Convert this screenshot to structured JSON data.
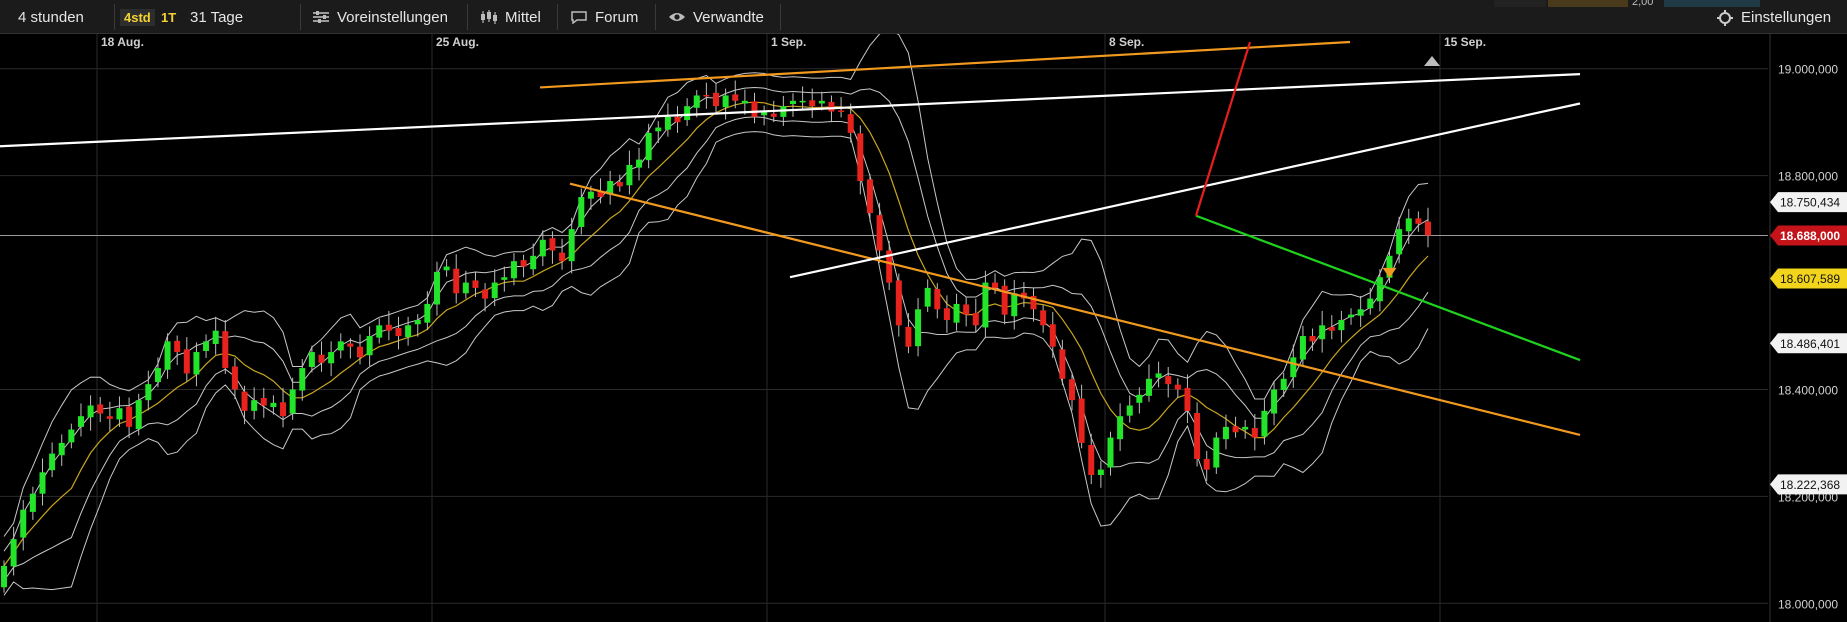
{
  "toolbar": {
    "interval": "4 stunden",
    "tf_4std": "4std",
    "tf_1t": "1T",
    "range": "31 Tage",
    "presets": "Voreinstellungen",
    "averages": "Mittel",
    "forum": "Forum",
    "related": "Verwandte",
    "settings": "Einstellungen",
    "top_value": "2,00"
  },
  "colors": {
    "bull": "#22e52a",
    "bear": "#e8221c",
    "orange": "#f19a1f",
    "white": "#ffffff",
    "green": "#1fd21f",
    "red": "#e81d1d",
    "gold": "#c8a520",
    "band": "#c8c8c8",
    "grid": "#2a2a2a"
  },
  "chart_data": {
    "type": "candlestick",
    "title": "",
    "xlabel": "",
    "ylabel": "",
    "ylim": [
      17965,
      19065
    ],
    "y_axis_side": "right",
    "grid": true,
    "y_ticks": [
      "19.000,000",
      "18.800,000",
      "18.400,000",
      "18.200,000",
      "18.000,000"
    ],
    "x_ticks": [
      "18 Aug.",
      "25 Aug.",
      "1 Sep.",
      "8 Sep.",
      "15 Sep."
    ],
    "price_labels": [
      {
        "text": "18.750,434",
        "value": 18750.434,
        "style": "white"
      },
      {
        "text": "18.688,000",
        "value": 18688.0,
        "style": "red"
      },
      {
        "text": "18.607,589",
        "value": 18607.589,
        "style": "yellow"
      },
      {
        "text": "18.486,401",
        "value": 18486.401,
        "style": "white"
      },
      {
        "text": "18.222,368",
        "value": 18222.368,
        "style": "white"
      }
    ],
    "current_price": 18688.0,
    "candle_closes": [
      18070,
      18120,
      18175,
      18205,
      18245,
      18280,
      18300,
      18325,
      18350,
      18370,
      18355,
      18345,
      18365,
      18330,
      18380,
      18410,
      18440,
      18490,
      18470,
      18430,
      18470,
      18490,
      18510,
      18440,
      18400,
      18360,
      18380,
      18370,
      18375,
      18350,
      18400,
      18440,
      18470,
      18450,
      18470,
      18490,
      18480,
      18460,
      18500,
      18520,
      18510,
      18500,
      18520,
      18530,
      18560,
      18620,
      18630,
      18580,
      18600,
      18590,
      18570,
      18600,
      18610,
      18640,
      18630,
      18650,
      18680,
      18660,
      18640,
      18700,
      18760,
      18770,
      18760,
      18790,
      18780,
      18820,
      18830,
      18880,
      18890,
      18910,
      18900,
      18930,
      18950,
      18950,
      18930,
      18950,
      18940,
      18940,
      18910,
      18920,
      18910,
      18930,
      18940,
      18940,
      18930,
      18940,
      18920,
      18920,
      18880,
      18790,
      18730,
      18660,
      18600,
      18520,
      18480,
      18550,
      18590,
      18550,
      18530,
      18560,
      18540,
      18520,
      18600,
      18590,
      18540,
      18580,
      18570,
      18550,
      18520,
      18480,
      18420,
      18380,
      18300,
      18240,
      18250,
      18310,
      18350,
      18370,
      18390,
      18420,
      18430,
      18410,
      18400,
      18360,
      18270,
      18250,
      18310,
      18330,
      18320,
      18330,
      18310,
      18360,
      18400,
      18420,
      18460,
      18500,
      18490,
      18520,
      18510,
      18530,
      18540,
      18550,
      18570,
      18610,
      18650,
      18700,
      18720,
      18710,
      18688
    ],
    "overlays": {
      "moving_average": "gold",
      "bollinger_inner": "band",
      "bollinger_outer": "band"
    },
    "trendlines": [
      {
        "color": "white",
        "from": [
          0,
          18855
        ],
        "to": [
          1580,
          18990
        ],
        "label": ""
      },
      {
        "color": "orange",
        "from": [
          540,
          18965
        ],
        "to": [
          1350,
          19050
        ],
        "label": ""
      },
      {
        "color": "orange",
        "from": [
          570,
          18785
        ],
        "to": [
          1580,
          18315
        ],
        "label": ""
      },
      {
        "color": "white",
        "from": [
          790,
          18610
        ],
        "to": [
          1580,
          18935
        ],
        "label": ""
      },
      {
        "color": "green",
        "from": [
          1196,
          18725
        ],
        "to": [
          1580,
          18455
        ],
        "label": ""
      },
      {
        "color": "red",
        "from": [
          1196,
          18725
        ],
        "to": [
          1250,
          19050
        ],
        "label": ""
      }
    ]
  }
}
